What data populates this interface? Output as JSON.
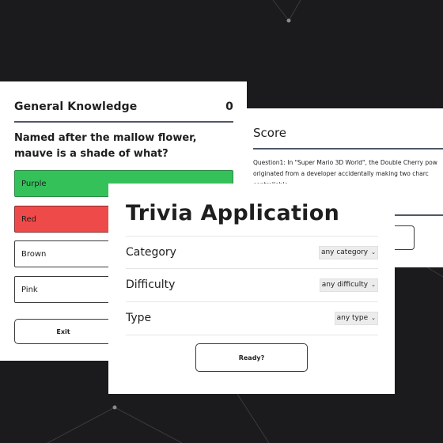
{
  "quiz": {
    "category": "General Knowledge",
    "score": "0",
    "question": "Named after the mallow flower, mauve is a shade of what?",
    "answers": [
      {
        "label": "Purple",
        "state": "correct"
      },
      {
        "label": "Red",
        "state": "wrong"
      },
      {
        "label": "Brown",
        "state": "neutral"
      },
      {
        "label": "Pink",
        "state": "neutral"
      }
    ],
    "exit_label": "Exit"
  },
  "score_screen": {
    "title": "Score",
    "line1": "Question1: In \"Super Mario 3D World\", the Double Cherry pow",
    "line2": "originated from a developer accidentally making two charc",
    "line3": "controllable."
  },
  "setup": {
    "title": "Trivia Application",
    "category_label": "Category",
    "category_value": "any category",
    "difficulty_label": "Difficulty",
    "difficulty_value": "any difficulty",
    "type_label": "Type",
    "type_value": "any type",
    "ready_label": "Ready?"
  },
  "colors": {
    "background": "#1b1b1d",
    "correct": "#34c15a",
    "wrong": "#ef4a4a",
    "rule": "#505868"
  }
}
